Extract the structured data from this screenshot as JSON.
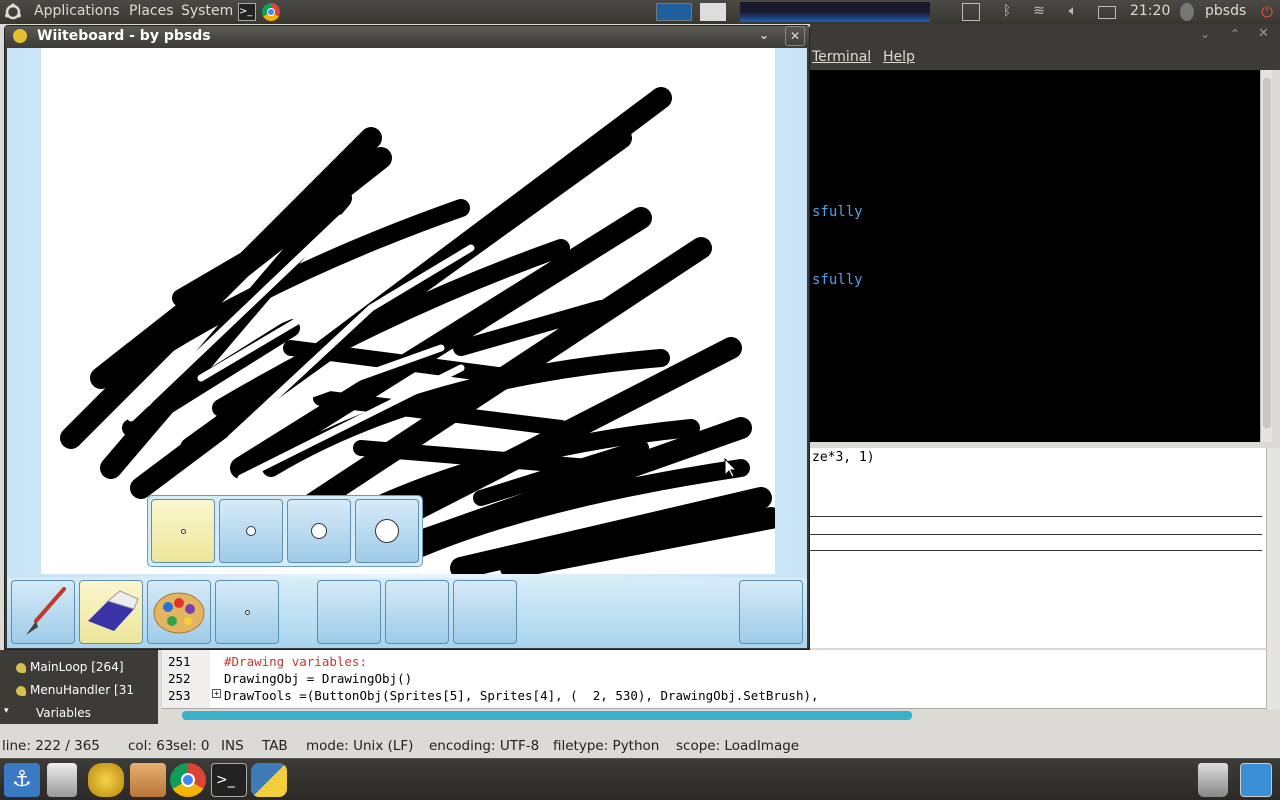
{
  "top_panel": {
    "menus": [
      "Applications",
      "Places",
      "System"
    ],
    "clock": "21:20",
    "user": "pbsds"
  },
  "terminal": {
    "menus": [
      "Terminal",
      "Help"
    ],
    "lines": [
      "sfully",
      "sfully"
    ]
  },
  "editor": {
    "fragment": "ze*3, 1)"
  },
  "sidebar": {
    "items": [
      "MainLoop [264]",
      "MenuHandler [31",
      "Variables"
    ]
  },
  "code": {
    "lines": [
      {
        "num": "251",
        "text": "#Drawing variables:"
      },
      {
        "num": "252",
        "text": "DrawingObj = DrawingObj()"
      },
      {
        "num": "253",
        "text": "DrawTools =(ButtonObj(Sprites[5], Sprites[4], (  2, 530), DrawingObj.SetBrush),"
      }
    ]
  },
  "statusbar": {
    "line": "line: 222 / 365",
    "col": "col: 63",
    "sel": "sel: 0",
    "ins": "INS",
    "tab": "TAB",
    "mode": "mode: Unix (LF)",
    "encoding": "encoding: UTF-8",
    "filetype": "filetype: Python",
    "scope": "scope: LoadImage"
  },
  "wiiteboard": {
    "title": "Wiiteboard - by pbsds",
    "tools": [
      "brush-icon",
      "eraser-icon",
      "palette-icon",
      "size-icon"
    ],
    "active_tool": "eraser",
    "brush_sizes": [
      "tiny",
      "small",
      "medium",
      "large"
    ],
    "active_size": "tiny"
  },
  "colors": {
    "panel": "#3c3b37",
    "wb_blue": "#a8d4ee",
    "active_yellow": "#ece59a",
    "code_red": "#c0392b"
  }
}
